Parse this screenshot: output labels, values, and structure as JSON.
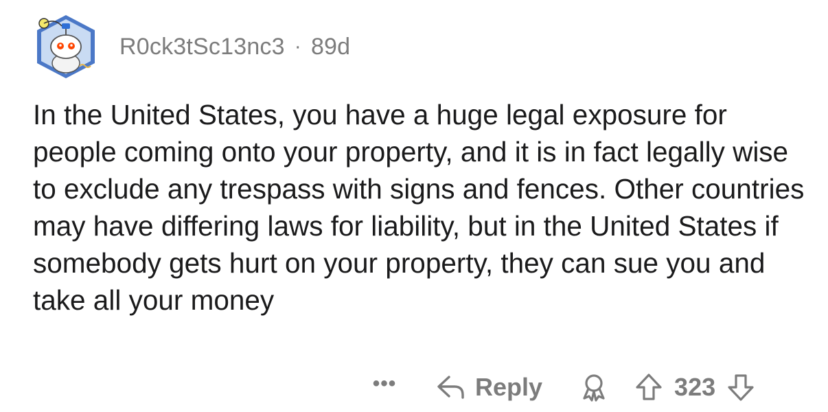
{
  "comment": {
    "author": "R0ck3tSc13nc3",
    "separator": "·",
    "age": "89d",
    "body": "In the United States, you have a huge legal exposure for people coming onto your property, and it is in fact legally wise to exclude any trespass with signs and fences. Other countries may have differing laws for liability, but in the United States if somebody gets hurt on your property, they can sue you and take all your money",
    "actions": {
      "more_label": "•••",
      "reply_label": "Reply",
      "score": "323"
    }
  },
  "icons": {
    "avatar": "snoo-avatar-icon",
    "reply": "reply-arrow-icon",
    "award": "award-icon",
    "upvote": "upvote-arrow-icon",
    "downvote": "downvote-arrow-icon"
  },
  "colors": {
    "text": "#1a1a1b",
    "muted": "#7c7c7c",
    "avatar_ring": "#5a7fc0"
  }
}
